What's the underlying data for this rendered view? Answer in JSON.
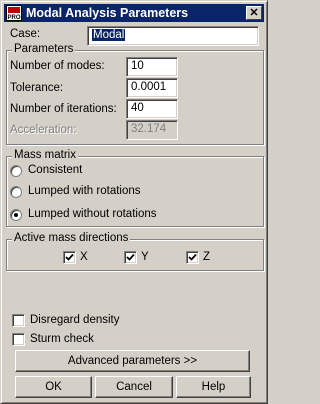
{
  "window": {
    "title": "Modal Analysis Parameters",
    "app_icon": "pro-app-icon",
    "close_label": "✕"
  },
  "case": {
    "label": "Case:",
    "value": "Modal"
  },
  "parameters": {
    "title": "Parameters",
    "modes_label": "Number of modes:",
    "modes_value": "10",
    "tolerance_label": "Tolerance:",
    "tolerance_value": "0.0001",
    "iterations_label": "Number of iterations:",
    "iterations_value": "40",
    "acceleration_label": "Acceleration:",
    "acceleration_value": "32.174"
  },
  "mass_matrix": {
    "title": "Mass matrix",
    "consistent": "Consistent",
    "lumped_rot": "Lumped with rotations",
    "lumped_no_rot": "Lumped without rotations",
    "selected": "lumped_no_rot"
  },
  "directions": {
    "title": "Active mass directions",
    "x": "X",
    "y": "Y",
    "z": "Z",
    "x_checked": true,
    "y_checked": true,
    "z_checked": true
  },
  "options": {
    "disregard_density": "Disregard density",
    "sturm_check": "Sturm check",
    "disregard_checked": false,
    "sturm_checked": false
  },
  "buttons": {
    "advanced": "Advanced parameters >>",
    "ok": "OK",
    "cancel": "Cancel",
    "help": "Help"
  }
}
